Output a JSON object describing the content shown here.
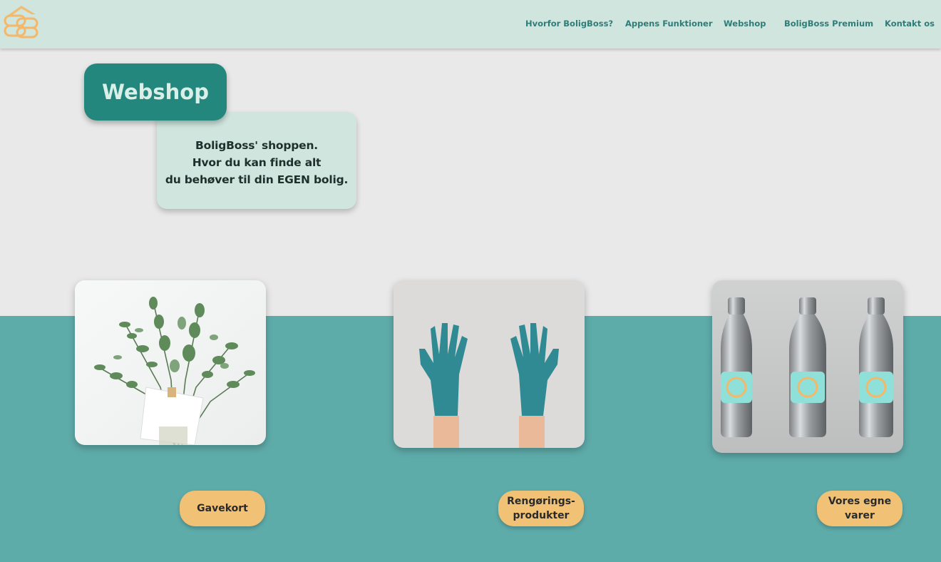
{
  "header": {
    "logo_icon": "boligboss-bb-logo-icon",
    "nav": [
      {
        "label": "Hvorfor BoligBoss?"
      },
      {
        "label": "Appens Funktioner"
      },
      {
        "label": "Webshop"
      },
      {
        "label": "BoligBoss Premium"
      },
      {
        "label": "Kontakt os"
      }
    ]
  },
  "main": {
    "title": "Webshop",
    "intro": {
      "line1": "BoligBoss' shoppen.",
      "line2": "Hvor du kan finde alt",
      "line3": "du behøver til din EGEN bolig."
    }
  },
  "products": [
    {
      "image_icon": "eucalyptus-bouquet-image",
      "button_label": "Gavekort"
    },
    {
      "image_icon": "cleaning-gloves-image",
      "button_label": "Rengørings- produkter"
    },
    {
      "image_icon": "branded-bottles-image",
      "button_label": "Vores egne varer"
    }
  ],
  "colors": {
    "header_bg": "#cfe5de",
    "nav_text": "#2f7d78",
    "title_bg": "#24877d",
    "teal_band": "#5eacaa",
    "button_bg": "#f1c276",
    "logo_orange": "#f3b86a"
  }
}
